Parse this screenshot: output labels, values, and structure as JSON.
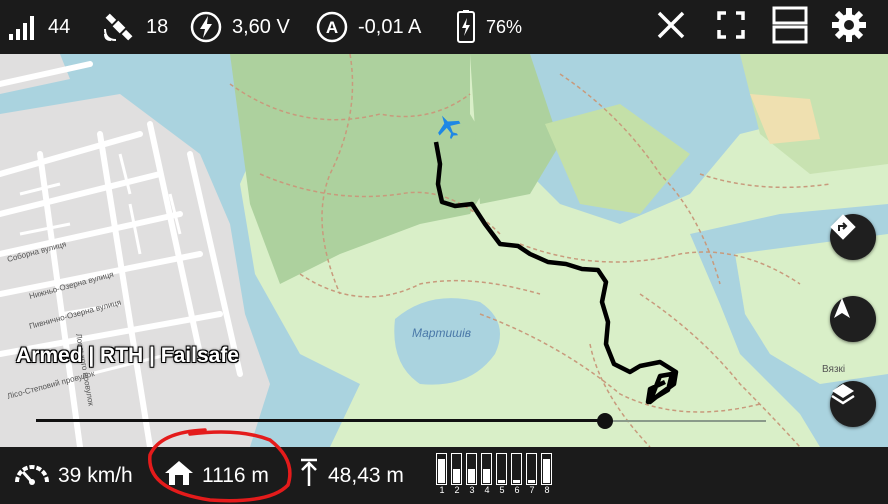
{
  "topbar": {
    "rssi": "44",
    "satellites": "18",
    "voltage": "3,60 V",
    "current": "-0,01 A",
    "battery": "76%"
  },
  "map": {
    "place_label": "Мартишів",
    "place_label_2": "Вязкі",
    "street_labels": [
      "Соборна вулиця",
      "Нижньо-Озерна вулиця",
      "Пивнично-Озерна вулиця",
      "Ловського провулок",
      "Лісо-Степовий провулок"
    ],
    "flight_status": "Armed | RTH | Failsafe",
    "timeline_progress": 0.78
  },
  "bottombar": {
    "speed": "39 km/h",
    "home_distance": "1116 m",
    "altitude": "48,43 m",
    "channels": [
      {
        "label": "1",
        "level": 0.85
      },
      {
        "label": "2",
        "level": 0.5
      },
      {
        "label": "3",
        "level": 0.5
      },
      {
        "label": "4",
        "level": 0.5
      },
      {
        "label": "5",
        "level": 0.1
      },
      {
        "label": "6",
        "level": 0.1
      },
      {
        "label": "7",
        "level": 0.1
      },
      {
        "label": "8",
        "level": 0.85
      }
    ]
  },
  "colors": {
    "bar_bg": "#1b1b1b",
    "water": "#aad3df",
    "forest": "#add19e",
    "grass": "#d9efc8",
    "urban": "#e0dfdf",
    "plane": "#1e88e5",
    "annotation": "#e41b1b"
  }
}
